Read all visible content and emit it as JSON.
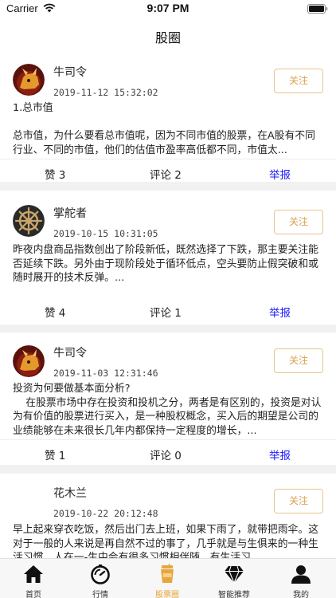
{
  "status": {
    "carrier": "Carrier",
    "time": "9:07 PM"
  },
  "nav": {
    "title": "股圈"
  },
  "colors": {
    "accent": "#e7a63c",
    "report_link": "#1a1aff",
    "follow_border": "#e9c48d"
  },
  "posts": [
    {
      "author": "牛司令",
      "time": "2019-11-12 15:32:02",
      "follow": "关注",
      "content_lines": [
        "1.总市值",
        "",
        "总市值，为什么要看总市值呢，因为不同市值的股票，在A股有不同行业、不同的市值，他们的估值市盈率高低都不同，市值太..."
      ],
      "likes": "赞 3",
      "comments": "评论 2",
      "report": "举报"
    },
    {
      "author": "掌舵者",
      "time": "2019-10-15 10:31:05",
      "follow": "关注",
      "content_lines": [
        "昨夜内盘商品指数创出了阶段新低，既然选择了下跌，那主要关注能否延续下跌。另外由于现阶段处于循环低点，空头要防止假突破和或随时展开的技术反弹。..."
      ],
      "likes": "赞 4",
      "comments": "评论 1",
      "report": "举报"
    },
    {
      "author": "牛司令",
      "time": "2019-11-03 12:31:46",
      "follow": "关注",
      "content_lines": [
        "投资为何要做基本面分析?",
        "    在股票市场中存在投资和投机之分，两者是有区别的，投资是对认为有价值的股票进行买入，是一种股权概念，买入后的期望是公司的业绩能够在未来很长几年内都保持一定程度的增长，..."
      ],
      "likes": "赞 1",
      "comments": "评论 0",
      "report": "举报"
    },
    {
      "author": "花木兰",
      "time": "2019-10-22 20:12:48",
      "follow": "关注",
      "content_lines": [
        "早上起来穿衣吃饭，然后出门去上班，如果下雨了，就带把雨伞。这对于一般的人来说是再自然不过的事了，几乎就是与生俱来的一种生活习惯。人在一-生中会有很多习惯相伴随，有生活习"
      ],
      "likes": "",
      "comments": "",
      "report": ""
    }
  ],
  "tabs": [
    {
      "label": "首页",
      "icon": "home-icon"
    },
    {
      "label": "行情",
      "icon": "stopwatch-icon"
    },
    {
      "label": "股票圈",
      "icon": "cup-icon",
      "active": true
    },
    {
      "label": "智能推荐",
      "icon": "diamond-icon"
    },
    {
      "label": "我的",
      "icon": "user-icon"
    }
  ]
}
